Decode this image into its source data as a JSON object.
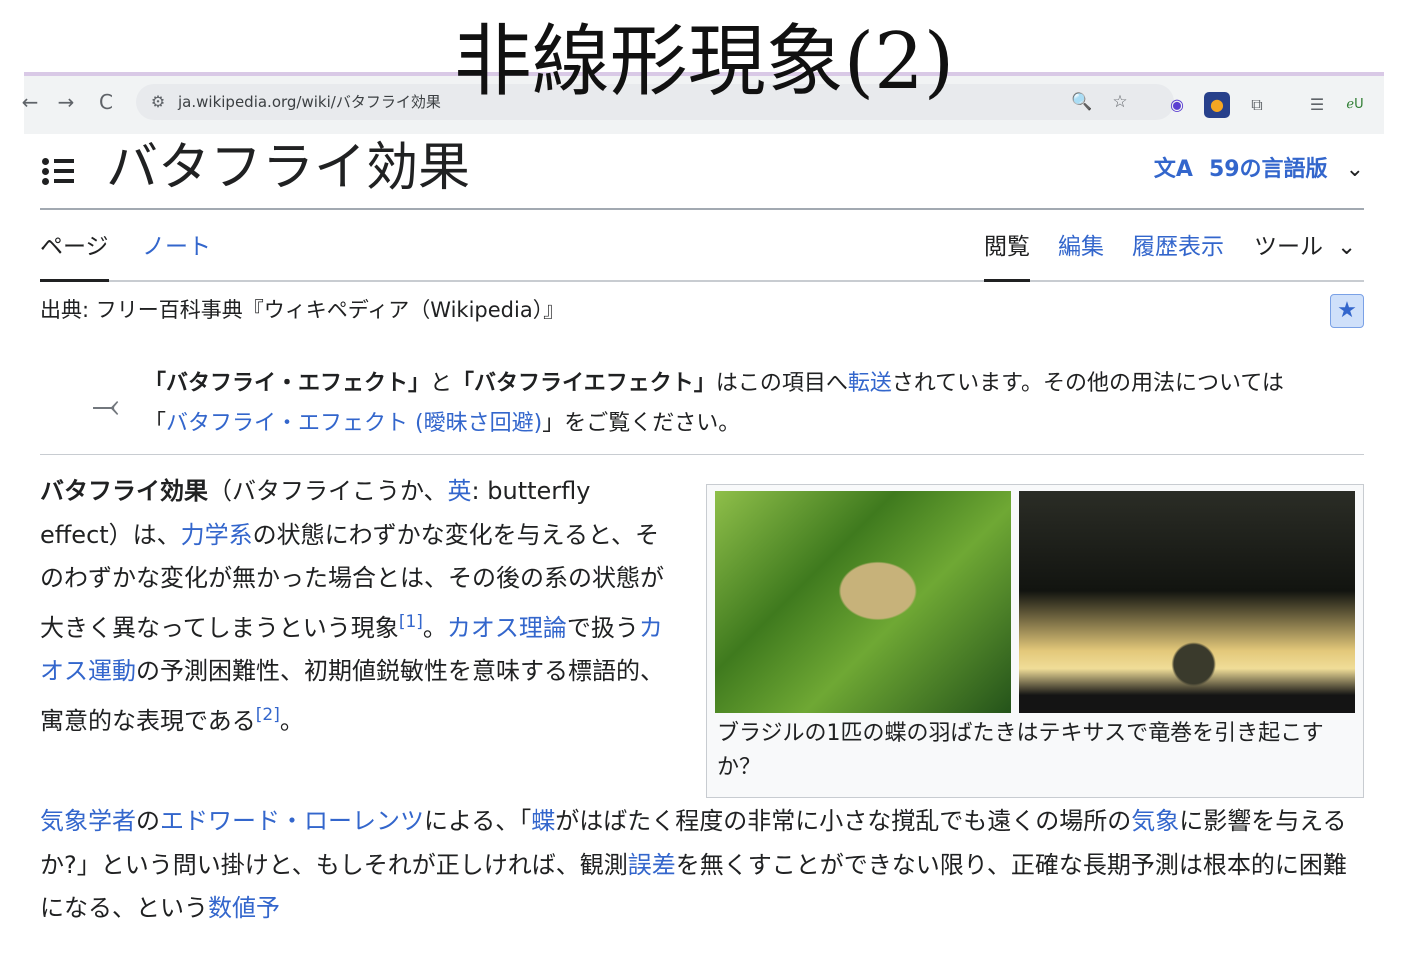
{
  "slide": {
    "title": "非線形現象(2)"
  },
  "browser": {
    "back": "←",
    "forward": "→",
    "reload": "C",
    "site_info_icon": "⚙",
    "url": "ja.wikipedia.org/wiki/バタフライ効果",
    "zoom_icon": "🔍",
    "star_icon": "☆",
    "menu_glyph": "☰"
  },
  "article": {
    "title": "バタフライ効果",
    "languages": "59の言語版",
    "translate_icon": "文A",
    "chevron": "⌄",
    "tabs_left": [
      "ページ",
      "ノート"
    ],
    "tabs_right": [
      "閲覧",
      "編集",
      "履歴表示",
      "ツール"
    ],
    "tools_chevron": "⌄",
    "source": "出典: フリー百科事典『ウィキペディア（Wikipedia）』",
    "star_badge": "★",
    "hatnote": {
      "icon": "⤙",
      "bold1": "「バタフライ・エフェクト」",
      "to": "と",
      "bold2": "「バタフライエフェクト」",
      "mid": "はこの項目へ",
      "link_redirect": "転送",
      "tail": "されています。その他の用法については「",
      "link_dab": "バタフライ・エフェクト (曖昧さ回避)",
      "end": "」をご覧ください。"
    },
    "lead": {
      "term": "バタフライ効果",
      "reading_open": "（バタフライこうか、",
      "lang_link": "英",
      "english": ": butterfly effect）は、",
      "link_dyn": "力学系",
      "t1": "の状態にわずかな変化を与えると、そのわずかな変化が無かった場合とは、その後の系の状態が大きく異なってしまうという現象",
      "ref1": "[1]",
      "t2": "。",
      "link_chaos": "カオス理論",
      "t3": "で扱う",
      "link_motion": "カオス運動",
      "t4": "の予測困難性、初期値鋭敏性を意味する標語的、寓意的な表現である",
      "ref2": "[2]",
      "t5": "。"
    },
    "figure": {
      "caption": "ブラジルの1匹の蝶の羽ばたきはテキサスで竜巻を引き起こすか？"
    },
    "para2": {
      "link_met": "気象学者",
      "t1": "の",
      "link_lorenz": "エドワード・ローレンツ",
      "t2": "による、「",
      "link_butterfly": "蝶",
      "t3": "がはばたく程度の非常に小さな撹乱でも遠くの場所の",
      "link_weather": "気象",
      "t4": "に影響を与えるか?」という問い掛けと、もしそれが正しければ、観測",
      "link_error": "誤差",
      "t5": "を無くすことができない限り、正確な長期予測は根本的に困難になる、という",
      "link_num": "数値予"
    }
  }
}
